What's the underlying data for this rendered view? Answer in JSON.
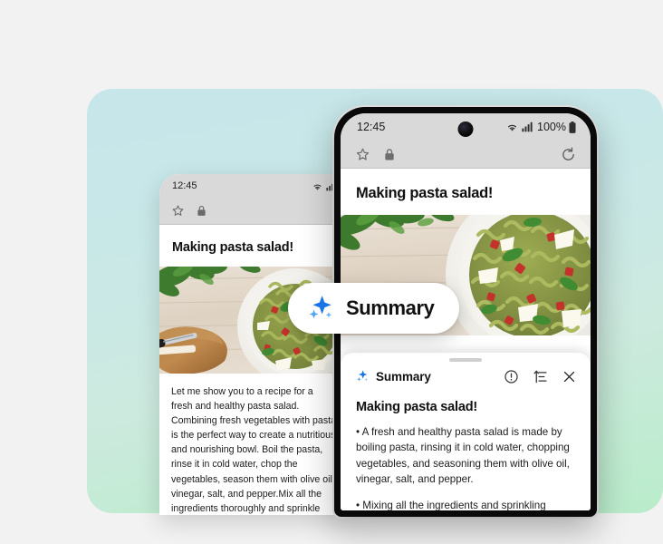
{
  "background": {
    "page_color": "#f2f2f2",
    "card_gradient_from": "#c6e6ea",
    "card_gradient_to": "#b9ecca"
  },
  "accent": {
    "sparkle_blue": "#1a73e8",
    "sparkle_light": "#4da3f5"
  },
  "phone_back": {
    "status": {
      "time": "12:45",
      "icons": [
        "wifi-icon",
        "signal-icon"
      ]
    },
    "toolbar": {
      "icons": [
        "bookmark-star-icon",
        "lock-icon"
      ]
    },
    "page_title": "Making pasta salad!",
    "photo_alt": "pasta-salad-photo",
    "article_text": "Let me show you to a recipe for a fresh and healthy pasta salad. Combining fresh vegetables with pasta is the perfect way to create a nutritious and nourishing bowl. Boil the pasta, rinse it in cold water, chop the vegetables, season them with olive oil, vinegar, salt, and pepper.Mix all the ingredients thoroughly and sprinkle parmesan cheese to complete the dish. Enjoy simple, healthy pasta!"
  },
  "phone_front": {
    "status": {
      "time": "12:45",
      "battery_text": "100%",
      "icons": [
        "wifi-icon",
        "signal-icon",
        "battery-icon"
      ]
    },
    "toolbar": {
      "icons": [
        "bookmark-star-icon",
        "lock-icon",
        "refresh-icon"
      ]
    },
    "page_title": "Making pasta salad!",
    "photo_alt": "pasta-salad-photo",
    "summary_sheet": {
      "header_label": "Summary",
      "header_icon": "sparkle-icon",
      "actions": [
        "info-circle-icon",
        "format-list-icon",
        "close-icon"
      ],
      "article_title": "Making pasta salad!",
      "bullets": [
        "• A fresh and healthy pasta salad is made by boiling pasta, rinsing it in cold water, chopping vegetables, and seasoning them with olive oil, vinegar, salt, and pepper.",
        "• Mixing all the ingredients and sprinkling parmesan cheese completes the dish."
      ]
    }
  },
  "summary_pill": {
    "label": "Summary",
    "icon": "sparkle-icon"
  }
}
